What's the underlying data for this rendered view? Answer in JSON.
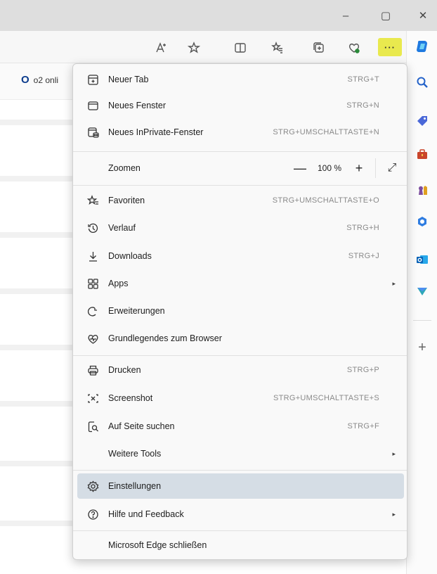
{
  "window": {
    "minimize": "–",
    "restore": "▢",
    "close": "✕"
  },
  "toolbar": {
    "more_label": "···"
  },
  "favorites_bar": {
    "item_label": "o2 onli",
    "logo": "O"
  },
  "menu": {
    "items": [
      {
        "label": "Neuer Tab",
        "shortcut": "STRG+T",
        "icon": "new-tab-icon"
      },
      {
        "label": "Neues Fenster",
        "shortcut": "STRG+N",
        "icon": "new-window-icon"
      },
      {
        "label": "Neues InPrivate-Fenster",
        "shortcut": "STRG+UMSCHALTTASTE+N",
        "icon": "inprivate-icon"
      },
      {
        "label": "Zoomen",
        "zoom_value": "100 %",
        "zoom_minus": "—",
        "zoom_plus": "+",
        "fullscreen": "⤢"
      },
      {
        "label": "Favoriten",
        "shortcut": "STRG+UMSCHALTTASTE+O",
        "icon": "favorites-icon"
      },
      {
        "label": "Verlauf",
        "shortcut": "STRG+H",
        "icon": "history-icon"
      },
      {
        "label": "Downloads",
        "shortcut": "STRG+J",
        "icon": "download-icon"
      },
      {
        "label": "Apps",
        "icon": "apps-icon"
      },
      {
        "label": "Erweiterungen",
        "icon": "extensions-icon"
      },
      {
        "label": "Grundlegendes zum Browser",
        "icon": "browser-essentials-icon"
      },
      {
        "label": "Drucken",
        "shortcut": "STRG+P",
        "icon": "print-icon"
      },
      {
        "label": "Screenshot",
        "shortcut": "STRG+UMSCHALTTASTE+S",
        "icon": "screenshot-icon"
      },
      {
        "label": "Auf Seite suchen",
        "shortcut": "STRG+F",
        "icon": "find-icon"
      },
      {
        "label": "Weitere Tools"
      },
      {
        "label": "Einstellungen",
        "icon": "settings-icon"
      },
      {
        "label": "Hilfe und Feedback",
        "icon": "help-icon"
      },
      {
        "label": "Microsoft Edge schließen"
      }
    ],
    "submenu_arrow": "▸"
  },
  "sidebar": {
    "add": "+"
  },
  "colors": {
    "highlight": "#d5dde5",
    "more_button": "#e9e94e"
  }
}
